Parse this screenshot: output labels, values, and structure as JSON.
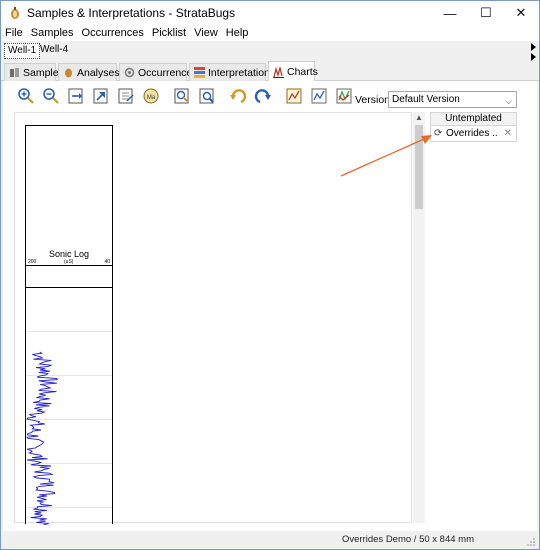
{
  "window": {
    "title": "Samples & Interpretations - StrataBugs",
    "controls": {
      "minimize": "—",
      "maximize": "☐",
      "close": "✕"
    }
  },
  "menu": [
    "File",
    "Samples",
    "Occurrences",
    "Picklist",
    "View",
    "Help"
  ],
  "well_tabs": [
    "Well-1",
    "Well-4"
  ],
  "main_tabs": [
    {
      "label": "Samples",
      "icon": "samples-icon"
    },
    {
      "label": "Analyses",
      "icon": "analyses-icon"
    },
    {
      "label": "Occurrences",
      "icon": "occurrences-icon"
    },
    {
      "label": "Interpretations",
      "icon": "interpretations-icon"
    },
    {
      "label": "Charts",
      "icon": "charts-icon",
      "active": true
    }
  ],
  "toolbar": {
    "version_label": "Version:",
    "version_value": "Default Version",
    "buttons": [
      "zoom-in-icon",
      "zoom-out-icon",
      "fit-width-icon",
      "fit-export-icon",
      "export-icon",
      "measure-icon",
      "zoom-window-icon",
      "zoom-region-icon",
      "undo-icon",
      "redo-icon",
      "chart-settings-icon",
      "chart-edit-icon",
      "chart-style-icon"
    ]
  },
  "chart": {
    "track_title": "Sonic Log",
    "scale_left": "200",
    "scale_unit": "(uS)",
    "scale_right": "40"
  },
  "right_panel": {
    "header": "Untemplated",
    "items": [
      {
        "label": "Overrides ..",
        "icon": "refresh-icon"
      }
    ]
  },
  "status": {
    "text": "Overrides Demo / 50 x 844 mm"
  },
  "colors": {
    "curve": "#1f1fd0",
    "annotation": "#e8692a",
    "window_border": "#7a9cc4"
  }
}
